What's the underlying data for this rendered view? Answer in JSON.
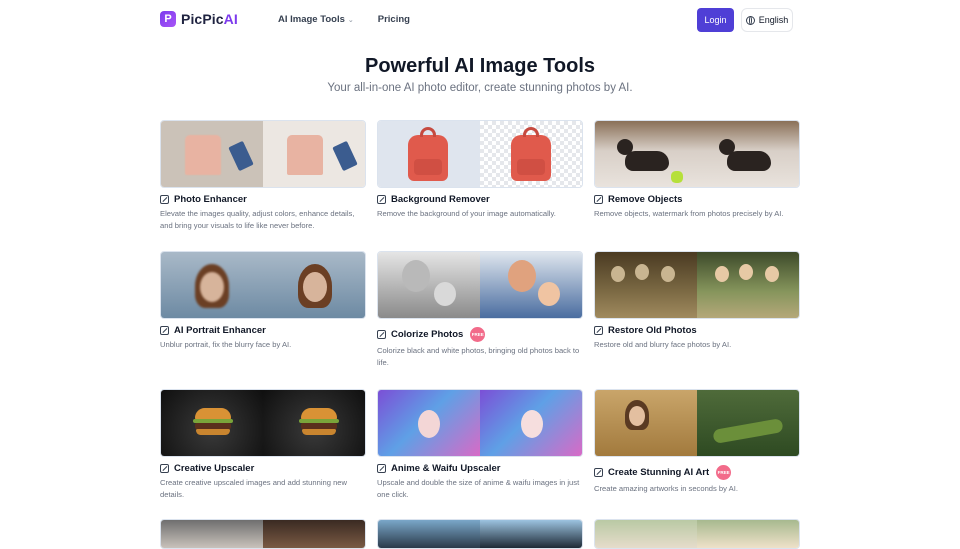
{
  "header": {
    "logo_text": "PicPic",
    "logo_ai": "AI",
    "nav": [
      {
        "label": "AI Image Tools",
        "has_dropdown": true
      },
      {
        "label": "Pricing",
        "has_dropdown": false
      }
    ],
    "login_label": "Login",
    "language_label": "English"
  },
  "hero": {
    "title": "Powerful AI Image Tools",
    "subtitle": "Your all-in-one AI photo editor, create stunning photos by AI."
  },
  "badges": {
    "free": "FREE"
  },
  "tools": [
    {
      "title": "Photo Enhancer",
      "desc": "Elevate the images quality, adjust colors, enhance details, and bring your visuals to life like never before.",
      "icon": "enhance-icon"
    },
    {
      "title": "Background Remover",
      "desc": "Remove the background of your image automatically.",
      "icon": "eraser-icon"
    },
    {
      "title": "Remove Objects",
      "desc": "Remove objects, watermark from photos precisely by AI.",
      "icon": "erase-object-icon"
    },
    {
      "title": "AI Portrait Enhancer",
      "desc": "Unblur portrait, fix the blurry face by AI.",
      "icon": "enhance-icon"
    },
    {
      "title": "Colorize Photos",
      "desc": "Colorize black and white photos, bringing old photos back to life.",
      "icon": "enhance-icon",
      "free": true
    },
    {
      "title": "Restore Old Photos",
      "desc": "Restore old and blurry face photos by AI.",
      "icon": "enhance-icon"
    },
    {
      "title": "Creative Upscaler",
      "desc": "Create creative upscaled images and add stunning new details.",
      "icon": "enhance-icon"
    },
    {
      "title": "Anime & Waifu Upscaler",
      "desc": "Upscale and double the size of anime & waifu images in just one click.",
      "icon": "enhance-icon"
    },
    {
      "title": "Create Stunning AI Art",
      "desc": "Create amazing artworks in seconds by AI.",
      "icon": "ai-art-icon",
      "free": true
    }
  ],
  "colors": {
    "brand": "#7c3aed",
    "login_bg": "#4f3fd6",
    "free_badge": "#f26b8a"
  }
}
